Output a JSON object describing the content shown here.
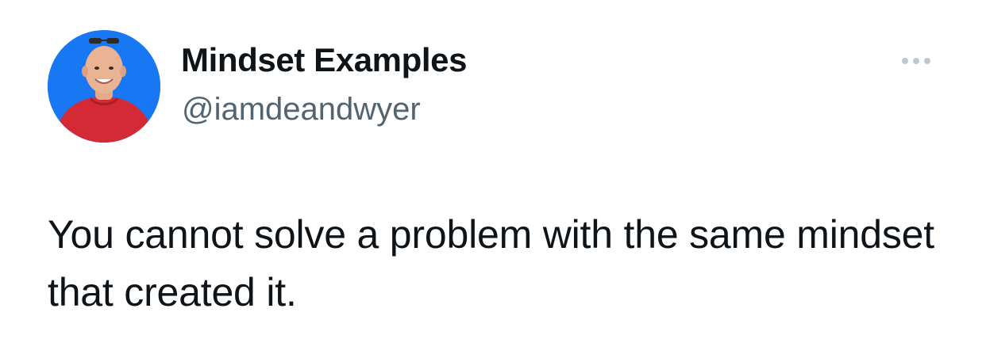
{
  "author": {
    "display_name": "Mindset Examples",
    "handle": "@iamdeandwyer",
    "avatar_alt": "avatar"
  },
  "tweet": {
    "text": "You cannot solve a problem with the same mindset that created it."
  },
  "menu": {
    "icon": "more-horizontal-icon"
  },
  "colors": {
    "avatar_bg": "#1877f2",
    "shirt": "#d42a35",
    "handle_text": "#536471",
    "dots": "#bfc8d0"
  }
}
